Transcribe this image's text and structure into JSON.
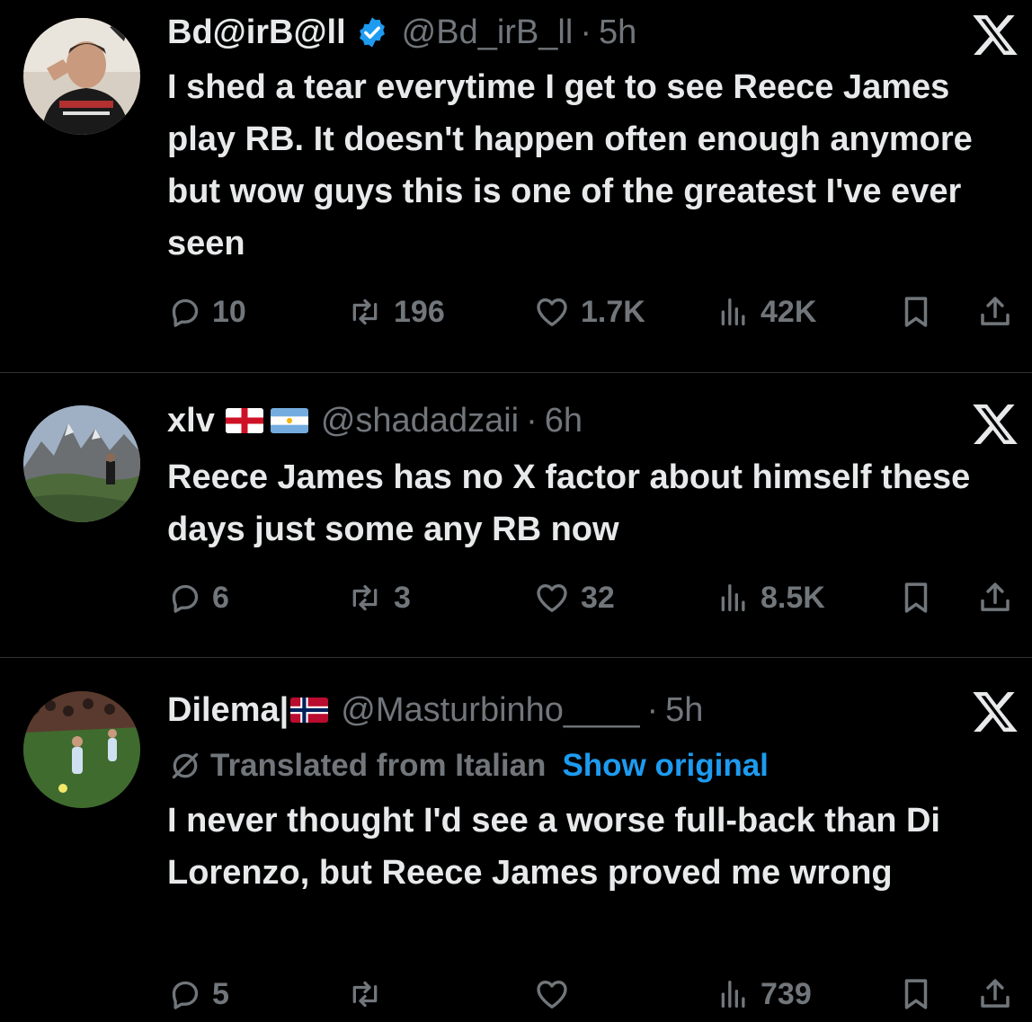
{
  "tweets": [
    {
      "name": "Bd@irB@ll",
      "handle": "@Bd_irB_ll",
      "time": "5h",
      "verified": true,
      "text": "I shed a tear everytime I get to see Reece James play RB. It doesn't happen often enough anymore but wow guys this is one of the greatest I've ever seen",
      "replies": "10",
      "reposts": "196",
      "likes": "1.7K",
      "views": "42K"
    },
    {
      "name": "xlv",
      "handle": "@shadadzaii",
      "time": "6h",
      "flags": [
        "england-flag",
        "argentina-flag"
      ],
      "text": "Reece James has no X factor about himself these days just some any RB now",
      "replies": "6",
      "reposts": "3",
      "likes": "32",
      "views": "8.5K"
    },
    {
      "name": "Dilema|",
      "handle": "@Masturbinho____",
      "time": "5h",
      "flags": [
        "norway-flag"
      ],
      "translated_label": "Translated from Italian",
      "show_original": "Show original",
      "text": "I never thought I'd see a worse full-back than Di Lorenzo, but Reece James proved me wrong",
      "replies": "5",
      "reposts": "",
      "likes": "",
      "views": "739"
    }
  ],
  "dot": "·",
  "colors": {
    "background": "#000000",
    "text": "#e7e9ea",
    "muted": "#71767b",
    "link": "#1d9bf0",
    "verified": "#1d9bf0",
    "divider": "#2f3336"
  },
  "icons": [
    "reply-icon",
    "repost-icon",
    "like-icon",
    "views-icon",
    "bookmark-icon",
    "share-icon",
    "x-logo-icon",
    "verified-badge-icon",
    "translate-icon"
  ]
}
